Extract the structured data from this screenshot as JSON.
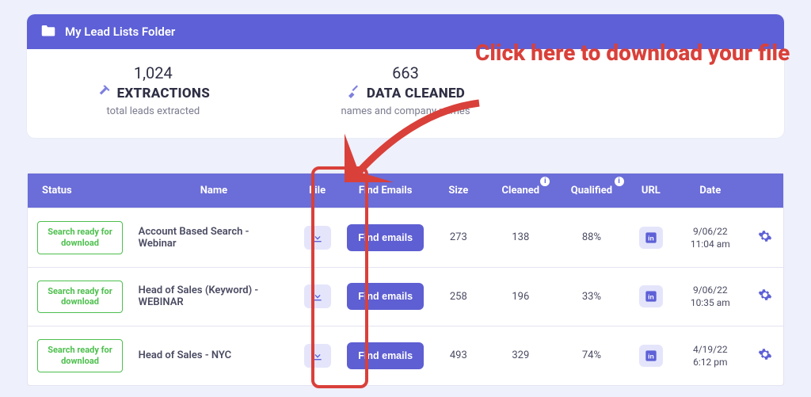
{
  "header": {
    "title": "My Lead Lists Folder"
  },
  "stats": [
    {
      "value": "1,024",
      "label": "EXTRACTIONS",
      "desc": "total leads extracted",
      "icon": "pickaxe"
    },
    {
      "value": "663",
      "label": "DATA CLEANED",
      "desc": "names and company names",
      "icon": "broom"
    }
  ],
  "callout": "Click here to download your file",
  "columns": {
    "status": "Status",
    "name": "Name",
    "file": "File",
    "find": "Find Emails",
    "size": "Size",
    "cleaned": "Cleaned",
    "qualified": "Qualified",
    "url": "URL",
    "date": "Date"
  },
  "status_badge_text": "Search ready for download",
  "find_button_label": "Find emails",
  "rows": [
    {
      "name": "Account Based Search - Webinar",
      "size": "273",
      "cleaned": "138",
      "qualified": "88%",
      "date_line1": "9/06/22",
      "date_line2": "11:04 am"
    },
    {
      "name": "Head of Sales (Keyword) - WEBINAR",
      "size": "258",
      "cleaned": "196",
      "qualified": "33%",
      "date_line1": "9/06/22",
      "date_line2": "10:35 am"
    },
    {
      "name": "Head of Sales - NYC",
      "size": "493",
      "cleaned": "329",
      "qualified": "74%",
      "date_line1": "4/19/22",
      "date_line2": "6:12 pm"
    }
  ]
}
